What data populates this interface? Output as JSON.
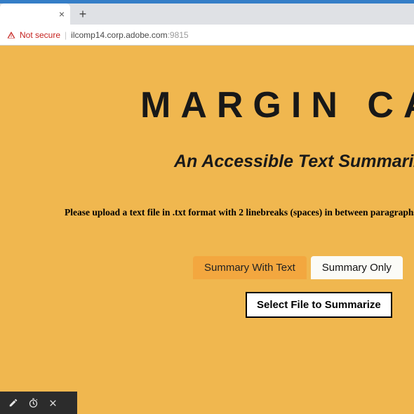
{
  "browser": {
    "tab_close_glyph": "×",
    "new_tab_glyph": "+",
    "not_secure_label": "Not secure",
    "url_host": "ilcomp14.corp.adobe.com",
    "url_port": ":9815"
  },
  "page": {
    "title": "MARGIN CALL",
    "subtitle": "An Accessible Text Summarizer",
    "instruction": "Please upload a text file in .txt format with 2 linebreaks (spaces) in between paragraphs",
    "tab_with_text": "Summary With Text",
    "tab_only": "Summary Only",
    "select_file_label": "Select File to Summarize"
  }
}
